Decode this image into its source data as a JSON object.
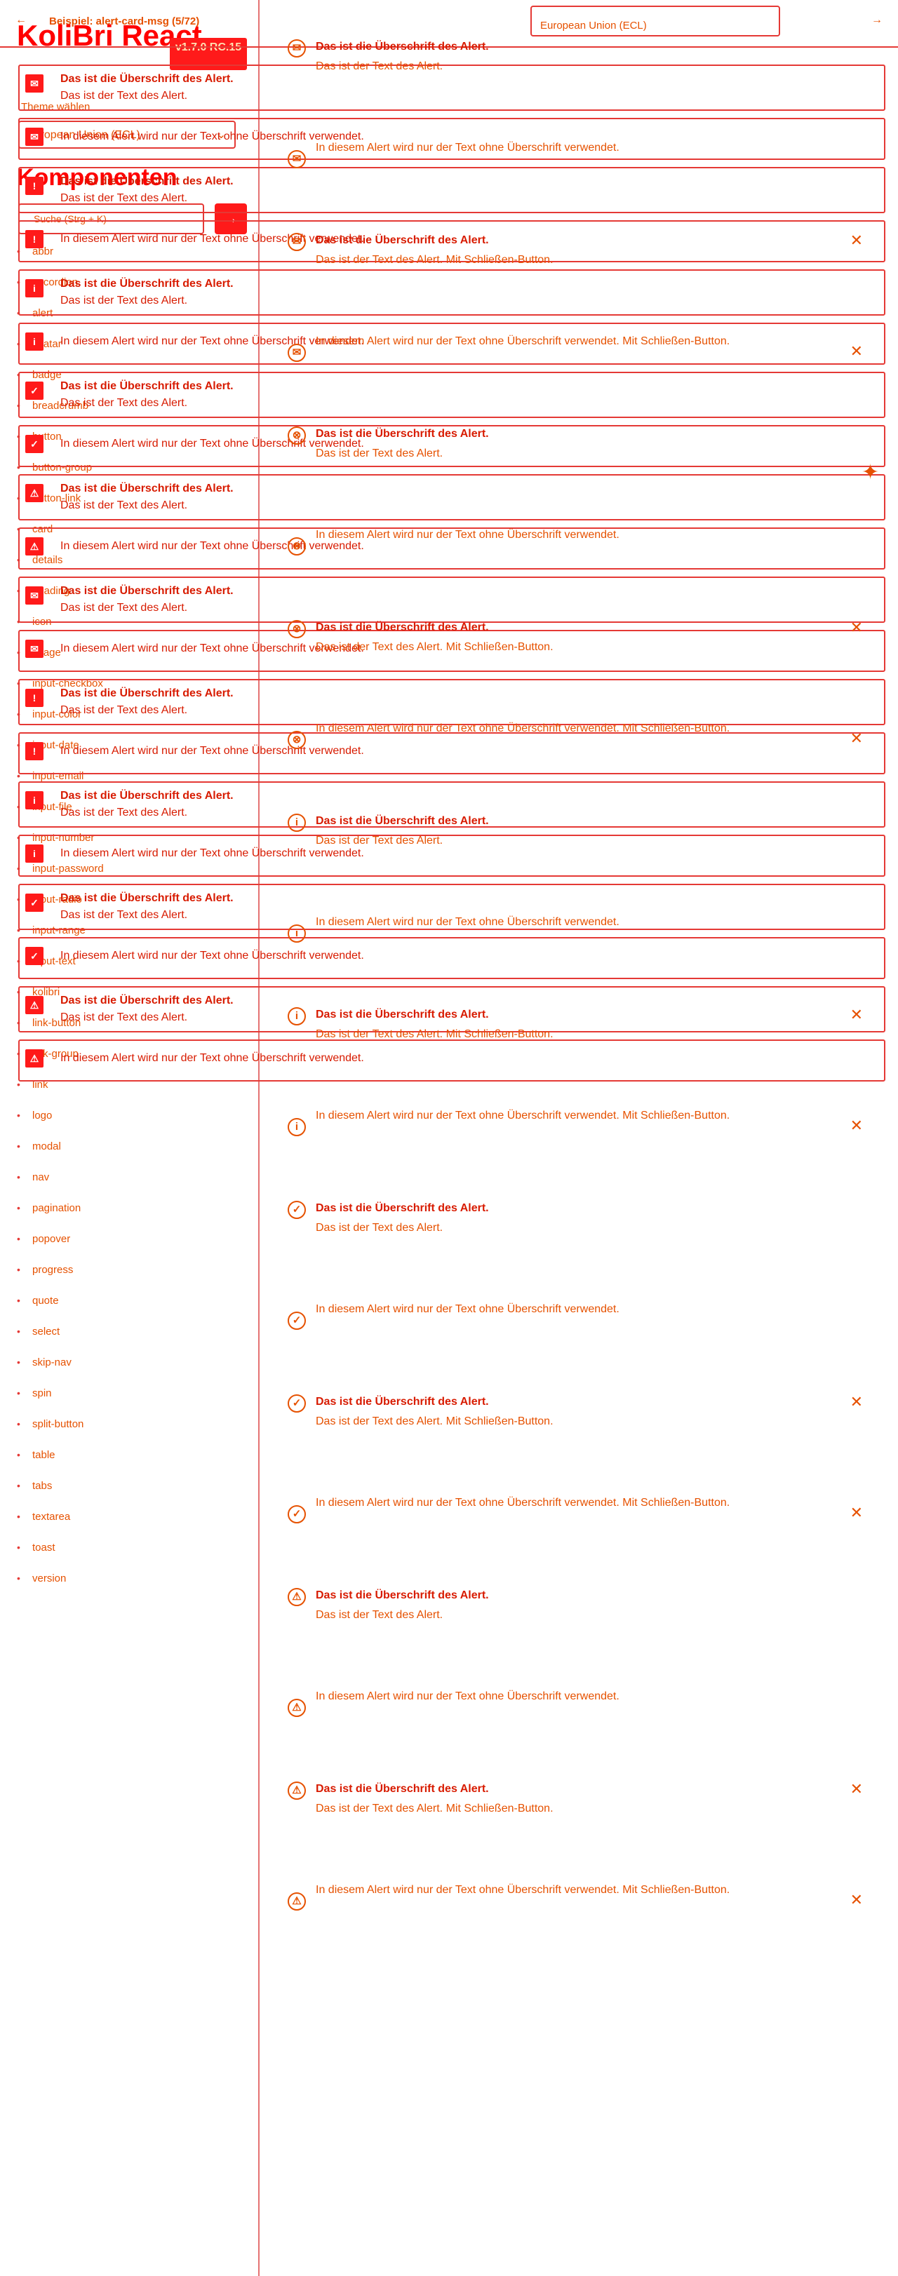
{
  "topbar": {
    "back_icon": "←",
    "example_title": "Beispiel: alert-card-msg (5/72)",
    "theme_value": "European Union (ECL)",
    "next_icon": "→"
  },
  "sidebar": {
    "brand": "KoliBri React",
    "version": "v1.7.0 RC.15",
    "theme_label": "Theme wählen",
    "theme_value": "European Union (ECL)",
    "components_heading": "Komponenten",
    "search_placeholder": "Suche (Strg + K)",
    "search_icon": "→",
    "nav": [
      {
        "label": "abbr"
      },
      {
        "label": "accordion"
      },
      {
        "label": "alert"
      },
      {
        "label": "avatar"
      },
      {
        "label": "badge"
      },
      {
        "label": "breadcrumb"
      },
      {
        "label": "button"
      },
      {
        "label": "button-group"
      },
      {
        "label": "button-link"
      },
      {
        "label": "card"
      },
      {
        "label": "details"
      },
      {
        "label": "heading"
      },
      {
        "label": "icon"
      },
      {
        "label": "image"
      },
      {
        "label": "input-checkbox"
      },
      {
        "label": "input-color"
      },
      {
        "label": "input-date"
      },
      {
        "label": "input-email"
      },
      {
        "label": "input-file"
      },
      {
        "label": "input-number"
      },
      {
        "label": "input-password"
      },
      {
        "label": "input-radio"
      },
      {
        "label": "input-range"
      },
      {
        "label": "input-text"
      },
      {
        "label": "kolibri"
      },
      {
        "label": "link-button"
      },
      {
        "label": "link-group"
      },
      {
        "label": "link"
      },
      {
        "label": "logo"
      },
      {
        "label": "modal"
      },
      {
        "label": "nav"
      },
      {
        "label": "pagination"
      },
      {
        "label": "popover"
      },
      {
        "label": "progress"
      },
      {
        "label": "quote"
      },
      {
        "label": "select"
      },
      {
        "label": "skip-nav"
      },
      {
        "label": "spin"
      },
      {
        "label": "split-button"
      },
      {
        "label": "table"
      },
      {
        "label": "tabs"
      },
      {
        "label": "textarea"
      },
      {
        "label": "toast"
      },
      {
        "label": "version"
      }
    ]
  },
  "alerts_left": [
    {
      "icon": "msg",
      "title": "Das ist die Überschrift des Alert.",
      "body": "Das ist der Text des Alert."
    },
    {
      "icon": "msg",
      "title": "",
      "body": "In diesem Alert wird nur der Text ohne Überschrift verwendet."
    },
    {
      "icon": "!",
      "title": "Das ist die Überschrift des Alert.",
      "body": "Das ist der Text des Alert."
    },
    {
      "icon": "!",
      "title": "",
      "body": "In diesem Alert wird nur der Text ohne Überschrift verwendet."
    },
    {
      "icon": "i",
      "title": "Das ist die Überschrift des Alert.",
      "body": "Das ist der Text des Alert."
    },
    {
      "icon": "i",
      "title": "",
      "body": "In diesem Alert wird nur der Text ohne Überschrift verwendet."
    },
    {
      "icon": "✓",
      "title": "Das ist die Überschrift des Alert.",
      "body": "Das ist der Text des Alert."
    },
    {
      "icon": "✓",
      "title": "",
      "body": "In diesem Alert wird nur der Text ohne Überschrift verwendet."
    },
    {
      "icon": "⚠",
      "title": "Das ist die Überschrift des Alert.",
      "body": "Das ist der Text des Alert."
    },
    {
      "icon": "⚠",
      "title": "",
      "body": "In diesem Alert wird nur der Text ohne Überschrift verwendet."
    },
    {
      "icon": "msg",
      "title": "Das ist die Überschrift des Alert.",
      "body": "Das ist der Text des Alert."
    },
    {
      "icon": "msg",
      "title": "",
      "body": "In diesem Alert wird nur der Text ohne Überschrift verwendet."
    },
    {
      "icon": "!",
      "title": "Das ist die Überschrift des Alert.",
      "body": "Das ist der Text des Alert."
    },
    {
      "icon": "!",
      "title": "",
      "body": "In diesem Alert wird nur der Text ohne Überschrift verwendet."
    },
    {
      "icon": "i",
      "title": "Das ist die Überschrift des Alert.",
      "body": "Das ist der Text des Alert."
    },
    {
      "icon": "i",
      "title": "",
      "body": "In diesem Alert wird nur der Text ohne Überschrift verwendet."
    },
    {
      "icon": "✓",
      "title": "Das ist die Überschrift des Alert.",
      "body": "Das ist der Text des Alert."
    },
    {
      "icon": "✓",
      "title": "",
      "body": "In diesem Alert wird nur der Text ohne Überschrift verwendet."
    },
    {
      "icon": "⚠",
      "title": "Das ist die Überschrift des Alert.",
      "body": "Das ist der Text des Alert."
    },
    {
      "icon": "⚠",
      "title": "",
      "body": "In diesem Alert wird nur der Text ohne Überschrift verwendet."
    }
  ],
  "alerts_right": [
    {
      "icon": "msg",
      "title": "Das ist die Überschrift des Alert.",
      "body": "Das ist der Text des Alert.",
      "close": false
    },
    {
      "icon": "msg",
      "title": "",
      "body": "In diesem Alert wird nur der Text ohne Überschrift verwendet.",
      "close": false
    },
    {
      "icon": "msg",
      "title": "Das ist die Überschrift des Alert.",
      "body": "Das ist der Text des Alert. Mit Schließen-Button.",
      "close": true
    },
    {
      "icon": "msg",
      "title": "",
      "body": "In diesem Alert wird nur der Text ohne Überschrift verwendet. Mit Schließen-Button.",
      "close": true
    },
    {
      "icon": "⊗",
      "title": "Das ist die Überschrift des Alert.",
      "body": "Das ist der Text des Alert.",
      "close": false
    },
    {
      "icon": "⊗",
      "title": "",
      "body": "In diesem Alert wird nur der Text ohne Überschrift verwendet.",
      "close": false
    },
    {
      "icon": "⊗",
      "title": "Das ist die Überschrift des Alert.",
      "body": "Das ist der Text des Alert. Mit Schließen-Button.",
      "close": true
    },
    {
      "icon": "⊗",
      "title": "",
      "body": "In diesem Alert wird nur der Text ohne Überschrift verwendet. Mit Schließen-Button.",
      "close": true
    },
    {
      "icon": "i",
      "title": "Das ist die Überschrift des Alert.",
      "body": "Das ist der Text des Alert.",
      "close": false
    },
    {
      "icon": "i",
      "title": "",
      "body": "In diesem Alert wird nur der Text ohne Überschrift verwendet.",
      "close": false
    },
    {
      "icon": "i",
      "title": "Das ist die Überschrift des Alert.",
      "body": "Das ist der Text des Alert. Mit Schließen-Button.",
      "close": true
    },
    {
      "icon": "i",
      "title": "",
      "body": "In diesem Alert wird nur der Text ohne Überschrift verwendet. Mit Schließen-Button.",
      "close": true
    },
    {
      "icon": "✓",
      "title": "Das ist die Überschrift des Alert.",
      "body": "Das ist der Text des Alert.",
      "close": false
    },
    {
      "icon": "✓",
      "title": "",
      "body": "In diesem Alert wird nur der Text ohne Überschrift verwendet.",
      "close": false
    },
    {
      "icon": "✓",
      "title": "Das ist die Überschrift des Alert.",
      "body": "Das ist der Text des Alert. Mit Schließen-Button.",
      "close": true
    },
    {
      "icon": "✓",
      "title": "",
      "body": "In diesem Alert wird nur der Text ohne Überschrift verwendet. Mit Schließen-Button.",
      "close": true
    },
    {
      "icon": "⚠",
      "title": "Das ist die Überschrift des Alert.",
      "body": "Das ist der Text des Alert.",
      "close": false
    },
    {
      "icon": "⚠",
      "title": "",
      "body": "In diesem Alert wird nur der Text ohne Überschrift verwendet.",
      "close": false
    },
    {
      "icon": "⚠",
      "title": "Das ist die Überschrift des Alert.",
      "body": "Das ist der Text des Alert. Mit Schließen-Button.",
      "close": true
    },
    {
      "icon": "⚠",
      "title": "",
      "body": "In diesem Alert wird nur der Text ohne Überschrift verwendet. Mit Schließen-Button.",
      "close": true
    }
  ],
  "close_icon": "✕",
  "pin_icon": "✦"
}
